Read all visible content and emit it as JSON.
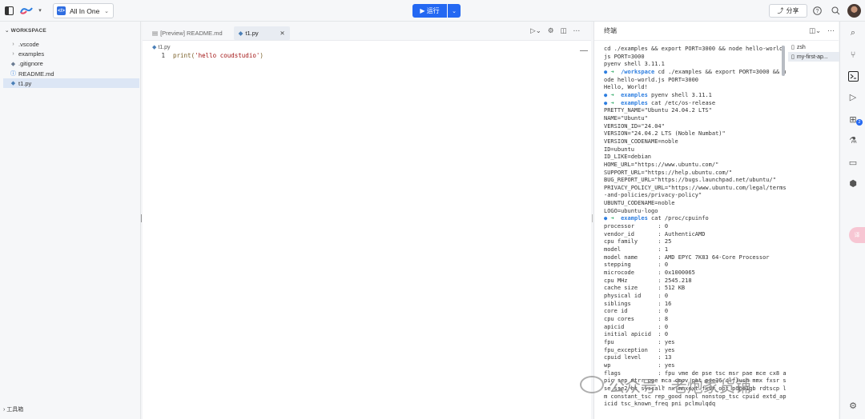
{
  "topbar": {
    "project_name": "All In One",
    "run_label": "▶ 运行",
    "share_label": "分享"
  },
  "sidebar": {
    "workspace_title": "WORKSPACE",
    "items": [
      {
        "label": ".vscode",
        "type": "folder"
      },
      {
        "label": "examples",
        "type": "folder"
      },
      {
        "label": ".gitignore",
        "type": "git"
      },
      {
        "label": "README.md",
        "type": "info"
      },
      {
        "label": "t1.py",
        "type": "python",
        "selected": true
      }
    ],
    "toolbox_label": "工具箱"
  },
  "editor": {
    "tabs": [
      {
        "label": "[Preview] README.md",
        "active": false
      },
      {
        "label": "t1.py",
        "active": true
      }
    ],
    "breadcrumb": "t1.py",
    "line_number": "1",
    "code_fn": "print(",
    "code_str": "'hello coudstudio'",
    "code_end": ")"
  },
  "terminal": {
    "title": "终端",
    "sessions": [
      {
        "label": "zsh"
      },
      {
        "label": "my-first-ap..."
      }
    ],
    "lines": [
      {
        "t": "cd ./examples && export PORT=3000 && node hello-world.js PORT=3000"
      },
      {
        "t": "pyenv shell 3.11.1"
      },
      {
        "cmd": true,
        "dir": "/workspace",
        "t": "cd ./examples && export PORT=3000 && node hello-world.js PORT=3000"
      },
      {
        "t": "Hello, World!"
      },
      {
        "cmd": true,
        "dir": "examples",
        "t": "pyenv shell 3.11.1"
      },
      {
        "cmd": true,
        "dir": "examples",
        "t": "cat /etc/os-release"
      },
      {
        "t": "PRETTY_NAME=\"Ubuntu 24.04.2 LTS\""
      },
      {
        "t": "NAME=\"Ubuntu\""
      },
      {
        "t": "VERSION_ID=\"24.04\""
      },
      {
        "t": "VERSION=\"24.04.2 LTS (Noble Numbat)\""
      },
      {
        "t": "VERSION_CODENAME=noble"
      },
      {
        "t": "ID=ubuntu"
      },
      {
        "t": "ID_LIKE=debian"
      },
      {
        "t": "HOME_URL=\"https://www.ubuntu.com/\""
      },
      {
        "t": "SUPPORT_URL=\"https://help.ubuntu.com/\""
      },
      {
        "t": "BUG_REPORT_URL=\"https://bugs.launchpad.net/ubuntu/\""
      },
      {
        "t": "PRIVACY_POLICY_URL=\"https://www.ubuntu.com/legal/terms-and-policies/privacy-policy\""
      },
      {
        "t": "UBUNTU_CODENAME=noble"
      },
      {
        "t": "LOGO=ubuntu-logo"
      },
      {
        "cmd": true,
        "dir": "examples",
        "t": "cat /proc/cpuinfo"
      },
      {
        "t": "processor       : 0"
      },
      {
        "t": "vendor_id       : AuthenticAMD"
      },
      {
        "t": "cpu family      : 25"
      },
      {
        "t": "model           : 1"
      },
      {
        "t": "model name      : AMD EPYC 7K83 64-Core Processor"
      },
      {
        "t": "stepping        : 0"
      },
      {
        "t": "microcode       : 0x1000065"
      },
      {
        "t": "cpu MHz         : 2545.218"
      },
      {
        "t": "cache size      : 512 KB"
      },
      {
        "t": "physical id     : 0"
      },
      {
        "t": "siblings        : 16"
      },
      {
        "t": "core id         : 0"
      },
      {
        "t": "cpu cores       : 8"
      },
      {
        "t": "apicid          : 0"
      },
      {
        "t": "initial apicid  : 0"
      },
      {
        "t": "fpu             : yes"
      },
      {
        "t": "fpu_exception   : yes"
      },
      {
        "t": "cpuid level     : 13"
      },
      {
        "t": "wp              : yes"
      },
      {
        "t": "flags           : fpu vme de pse tsc msr pae mce cx8 apic sep mtrr pge mca cmov pat pse36 clflush mmx fxsr sse sse2 ht syscall nx mmxext fxsr_opt pdpe1gb rdtscp lm constant_tsc rep_good nopl nonstop_tsc cpuid extd_apicid tsc_known_freq pni pclmulqdq"
      }
    ]
  },
  "rail": {
    "badge_count": "2"
  },
  "float_label": "译",
  "watermark": "公众号 · 老炮家货铺",
  "colors": {
    "accent": "#2468f2",
    "prompt_arrow": "#25a55f",
    "prompt_dir": "#2d7ee0"
  }
}
